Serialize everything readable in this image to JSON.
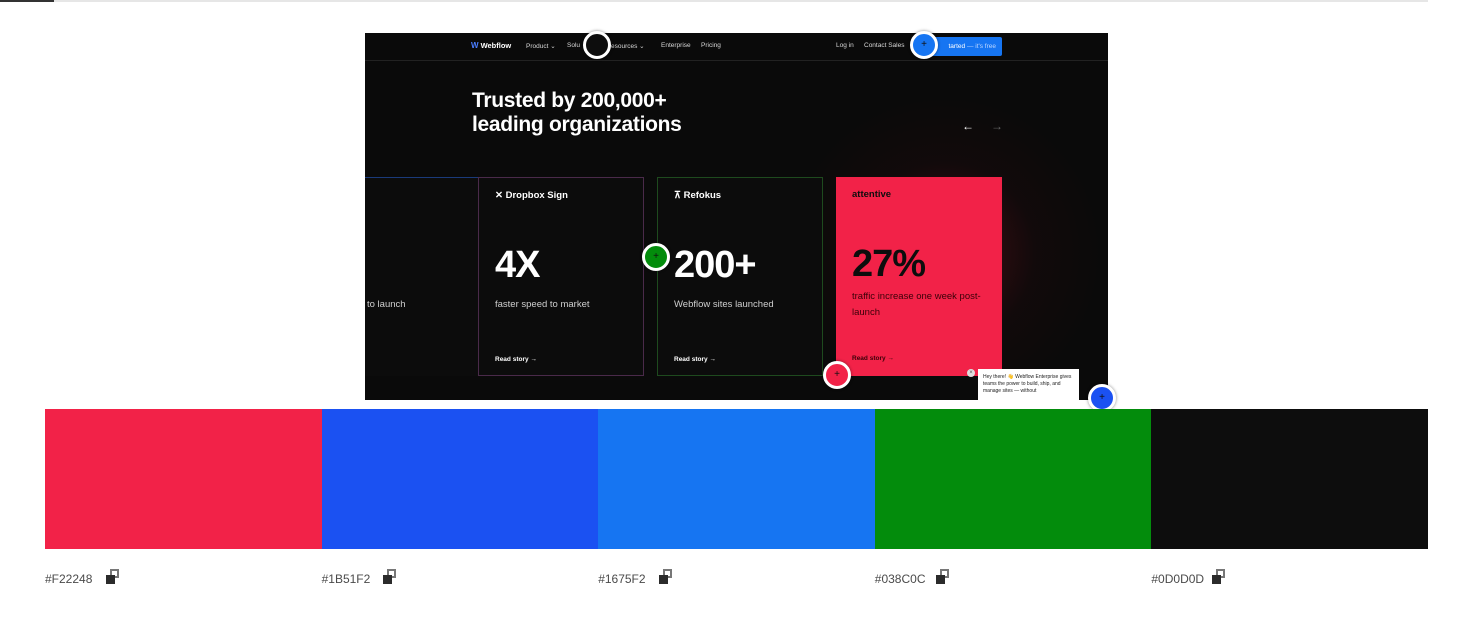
{
  "screenshot": {
    "nav": {
      "logo": "Webflow",
      "items": [
        "Product ⌄",
        "Solu",
        "esources ⌄",
        "Enterprise",
        "Pricing"
      ],
      "login": "Log in",
      "contact": "Contact Sales",
      "cta_main": "tarted",
      "cta_sub": "— it's free"
    },
    "headline_line1": "Trusted by 200,000+",
    "headline_line2": "leading organizations",
    "cards": [
      {
        "brand": "",
        "stat": "",
        "desc": "to launch",
        "story": ""
      },
      {
        "brand": "Dropbox Sign",
        "stat": "4X",
        "desc": "faster speed to market",
        "story": "Read story →"
      },
      {
        "brand": "Refokus",
        "stat": "200+",
        "desc": "Webflow sites launched",
        "story": "Read story →"
      },
      {
        "brand": "attentive",
        "stat": "27%",
        "desc": "traffic increase one week post-launch",
        "story": "Read story →"
      }
    ],
    "chat_text": "Hey there! 👋 Webflow Enterprise gives teams the power to build, ship, and manage sites — without"
  },
  "palette": [
    {
      "hex": "#F22248",
      "color": "#F22248"
    },
    {
      "hex": "#1B51F2",
      "color": "#1B51F2"
    },
    {
      "hex": "#1675F2",
      "color": "#1675F2"
    },
    {
      "hex": "#038C0C",
      "color": "#038C0C"
    },
    {
      "hex": "#0D0D0D",
      "color": "#0D0D0D"
    }
  ],
  "markers": [
    {
      "color": "#0D0D0D",
      "symbol": ""
    },
    {
      "color": "#1675F2",
      "symbol": "+"
    },
    {
      "color": "#038C0C",
      "symbol": "+"
    },
    {
      "color": "#F22248",
      "symbol": "+"
    },
    {
      "color": "#1B51F2",
      "symbol": "+"
    }
  ]
}
